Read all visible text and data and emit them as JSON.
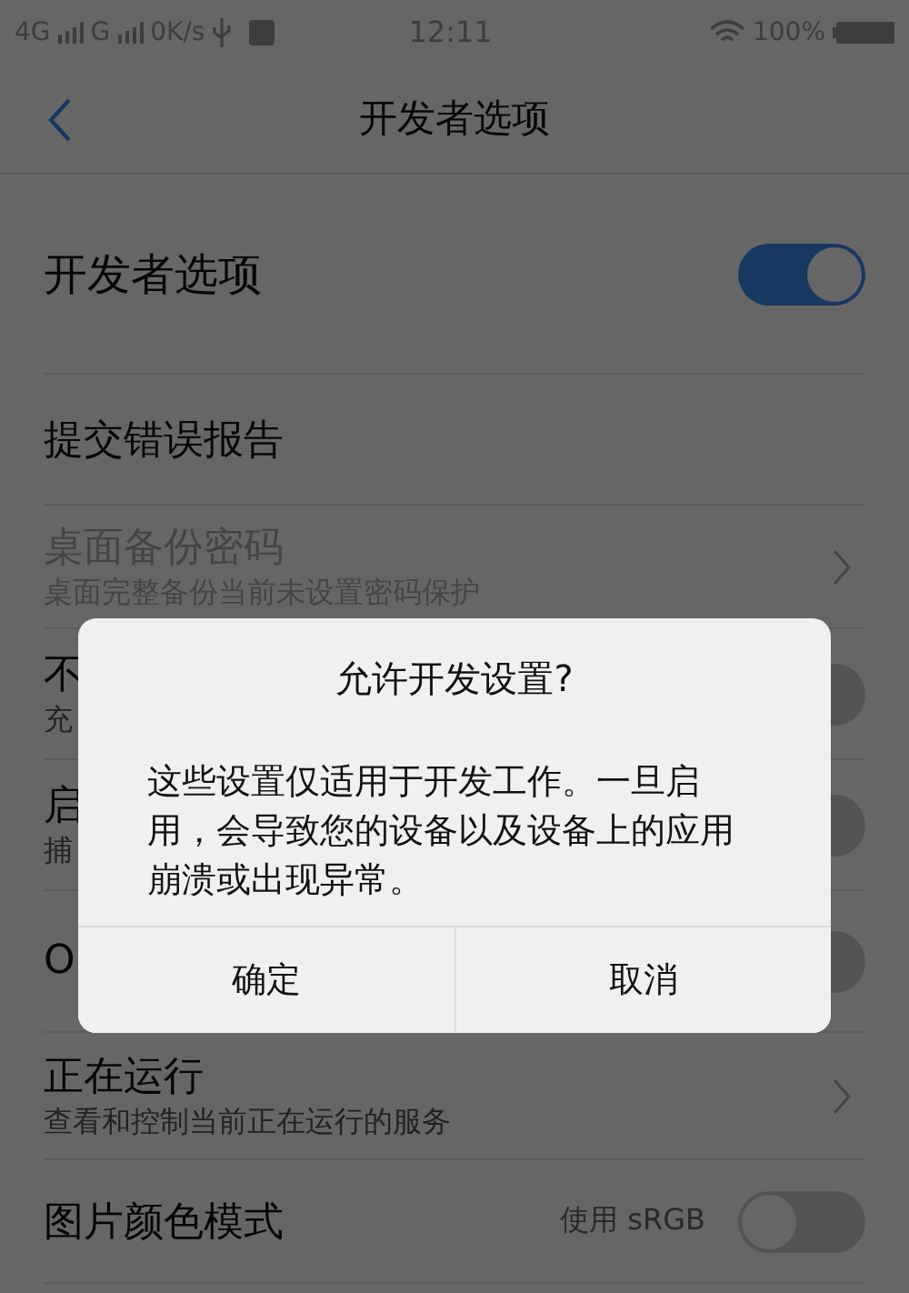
{
  "status_bar": {
    "network_1": "4G",
    "network_2": "G",
    "speed": "0K/s",
    "time": "12:11",
    "battery": "100%"
  },
  "header": {
    "title": "开发者选项"
  },
  "items": [
    {
      "kind": "switch",
      "title": "开发者选项",
      "on": true
    },
    {
      "kind": "plain",
      "title": "提交错误报告"
    },
    {
      "kind": "link",
      "title": "桌面备份密码",
      "subtitle": "桌面完整备份当前未设置密码保护",
      "disabled": true
    },
    {
      "kind": "switch",
      "title": "不",
      "subtitle": "充",
      "on": false
    },
    {
      "kind": "switch",
      "title": "启",
      "subtitle": "捕",
      "on": false
    },
    {
      "kind": "switch",
      "title": "O",
      "on": false
    },
    {
      "kind": "link",
      "title": "正在运行",
      "subtitle": "查看和控制当前正在运行的服务"
    },
    {
      "kind": "switch",
      "title": "图片颜色模式",
      "value": "使用 sRGB",
      "on": false
    }
  ],
  "dialog": {
    "title": "允许开发设置?",
    "message": "这些设置仅适用于开发工作。一旦启用，会导致您的设备以及设备上的应用崩溃或出现异常。",
    "buttons": [
      "确定",
      "取消"
    ]
  }
}
